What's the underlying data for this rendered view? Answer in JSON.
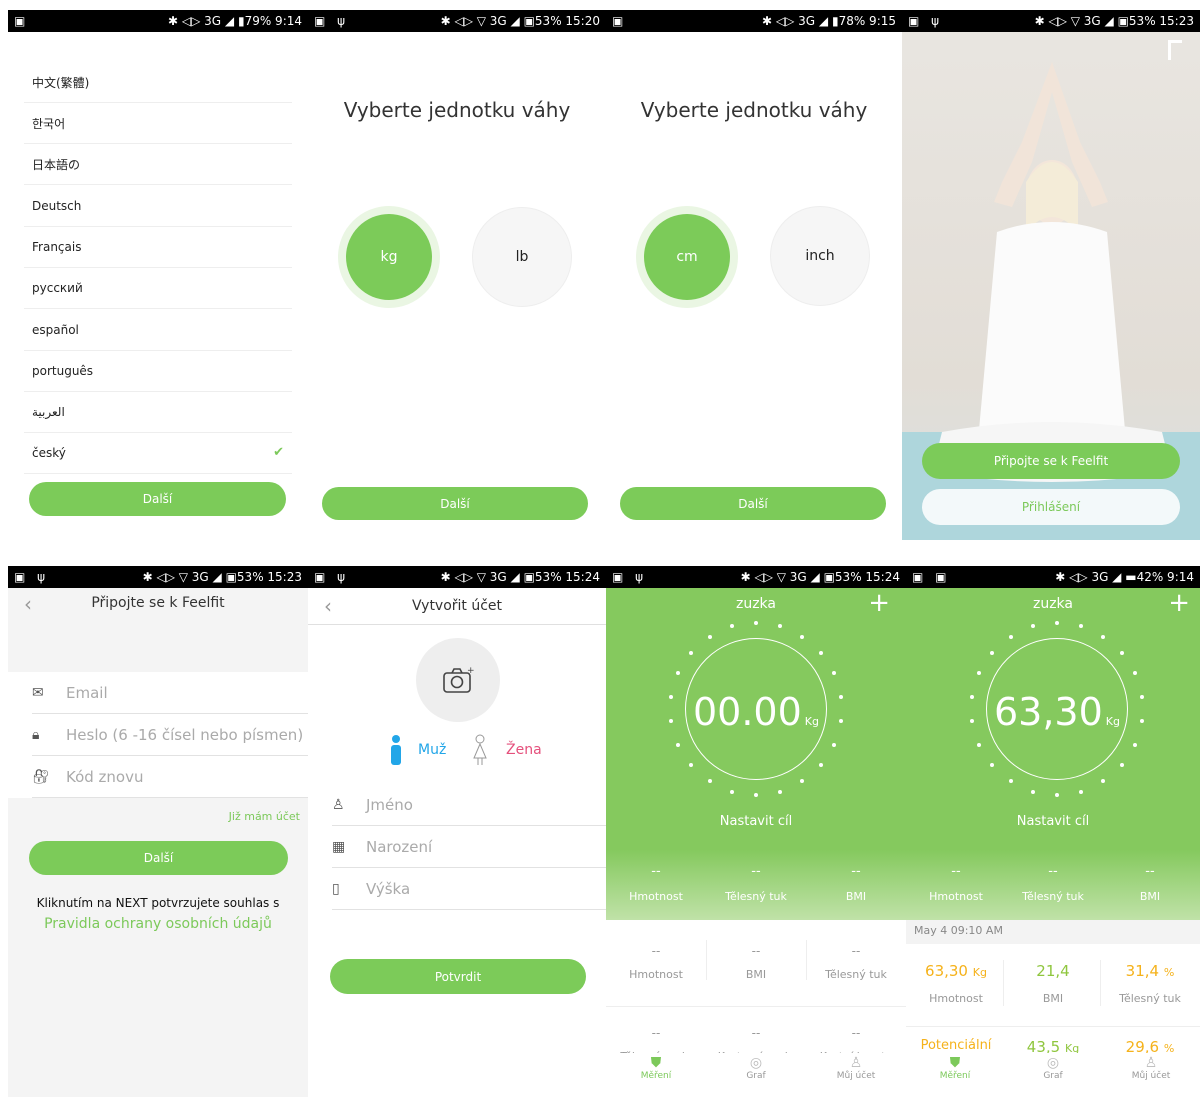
{
  "panel1": {
    "status_left": "▣",
    "status_right": "✱ ◁▷ 3G ◢ ▮79% 9:14",
    "languages": [
      "中文(繁體)",
      "한국어",
      "日本語の",
      "Deutsch",
      "Français",
      "русский",
      "español",
      "português",
      "العربية",
      "český"
    ],
    "selected_language": "český",
    "next_label": "Další"
  },
  "panel2": {
    "status_left": "▣ ψ",
    "status_right": "✱ ◁▷ ▽ 3G ◢ ▣53% 15:20",
    "title": "Vyberte jednotku váhy",
    "option_a": "kg",
    "option_b": "lb",
    "next_label": "Další"
  },
  "panel3": {
    "status_left": "▣",
    "status_right": "✱ ◁▷ 3G ◢ ▮78% 9:15",
    "title": "Vyberte jednotku váhy",
    "option_a": "cm",
    "option_b": "inch",
    "next_label": "Další"
  },
  "panel4": {
    "status_left": "▣ ψ",
    "status_right": "✱ ◁▷ ▽ 3G ◢ ▣53% 15:23",
    "connect_label": "Připojte se k Feelfit",
    "login_label": "Přihlášení"
  },
  "panel5": {
    "status_left": "▣ ψ",
    "status_right": "✱ ◁▷ ▽ 3G ◢ ▣53% 15:23",
    "header_title": "Připojte se k Feelfit",
    "email_placeholder": "Email",
    "password_placeholder": "Heslo (6 -16 čísel nebo písmen)",
    "repeat_placeholder": "Kód znovu",
    "have_account": "Již mám účet",
    "next_label": "Další",
    "consent_text": "Kliknutím na NEXT potvrzujete souhlas s",
    "privacy_link": "Pravidla ochrany osobních údajů"
  },
  "panel6": {
    "status_left": "▣ ψ",
    "status_right": "✱ ◁▷ ▽ 3G ◢ ▣53% 15:24",
    "header_title": "Vytvořit účet",
    "male_label": "Muž",
    "female_label": "Žena",
    "name_placeholder": "Jméno",
    "birth_placeholder": "Narození",
    "height_placeholder": "Výška",
    "confirm_label": "Potvrdit"
  },
  "panel7": {
    "status_left": "▣ ψ",
    "status_right": "✱ ◁▷ ▽ 3G ◢ ▣53% 15:24",
    "user": "zuzka",
    "weight": "00.00",
    "unit": "Kg",
    "goal": "Nastavit cíl",
    "stats": [
      {
        "value": "--",
        "label": "Hmotnost"
      },
      {
        "value": "--",
        "label": "Tělesný tuk"
      },
      {
        "value": "--",
        "label": "BMI"
      }
    ],
    "grid_row1": [
      {
        "value": "--",
        "label": "Hmotnost"
      },
      {
        "value": "--",
        "label": "BMI"
      },
      {
        "value": "--",
        "label": "Tělesný tuk"
      }
    ],
    "grid_row2": [
      {
        "value": "--",
        "label": "Tělesná voda"
      },
      {
        "value": "--",
        "label": "Kosterní svaly"
      },
      {
        "value": "--",
        "label": "Kostní hmota"
      }
    ],
    "nav": [
      "Měření",
      "Graf",
      "Můj účet"
    ]
  },
  "panel8": {
    "status_left": "▣ ▣",
    "status_right": "✱ ◁▷ 3G ◢ ▬42% 9:14",
    "user": "zuzka",
    "weight": "63,30",
    "unit": "Kg",
    "goal": "Nastavit cíl",
    "stats": [
      {
        "value": "--",
        "label": "Hmotnost"
      },
      {
        "value": "--",
        "label": "Tělesný tuk"
      },
      {
        "value": "--",
        "label": "BMI"
      }
    ],
    "date": "May 4 09:10 AM",
    "row1": [
      {
        "value": "63,30",
        "unit": "Kg",
        "label": "Hmotnost"
      },
      {
        "value": "21,4",
        "unit": "",
        "label": "BMI"
      },
      {
        "value": "31,4",
        "unit": "%",
        "label": "Tělesný tuk"
      }
    ],
    "row2": [
      {
        "value": "Potenciální",
        "unit": ""
      },
      {
        "value": "43,5",
        "unit": "Kg"
      },
      {
        "value": "29,6",
        "unit": "%"
      }
    ],
    "nav": [
      "Měření",
      "Graf",
      "Můj účet"
    ],
    "colors": {
      "green": "#85c95e",
      "orange": "#f5b21b",
      "green_value": "#8fc63e"
    }
  }
}
